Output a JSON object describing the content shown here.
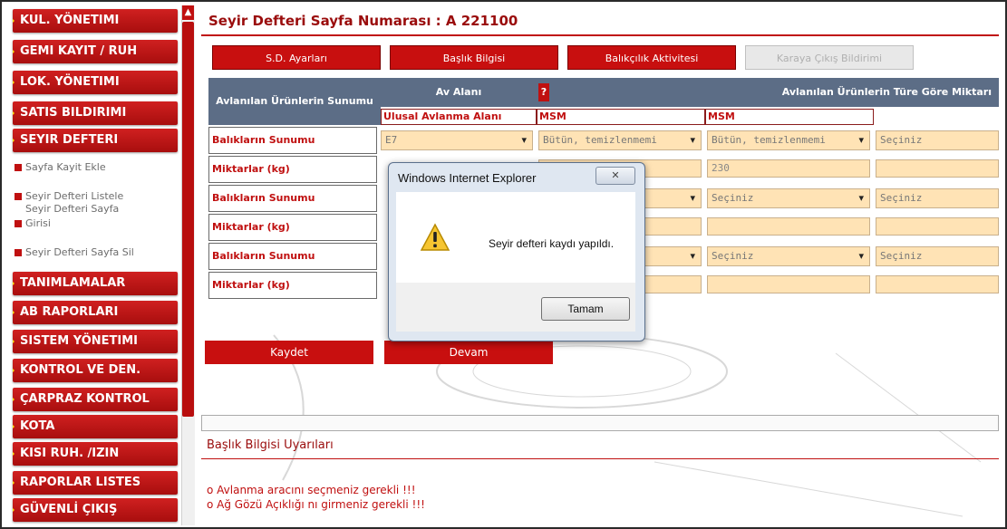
{
  "sidebar": {
    "items": [
      {
        "label": "KUL. YÖNETIMI"
      },
      {
        "label": "GEMI KAYIT / RUH"
      },
      {
        "label": "LOK. YÖNETIMI"
      },
      {
        "label": "SATIS BILDIRIMI"
      },
      {
        "label": "SEYIR DEFTERI"
      },
      {
        "label": "TANIMLAMALAR"
      },
      {
        "label": "AB RAPORLARI"
      },
      {
        "label": "SISTEM YÖNETIMI"
      },
      {
        "label": "KONTROL VE DEN."
      },
      {
        "label": "ÇARPRAZ KONTROL"
      },
      {
        "label": "KOTA"
      },
      {
        "label": "KISI RUH. /IZIN"
      },
      {
        "label": "RAPORLAR LISTES"
      },
      {
        "label": "GÜVENLİ ÇIKIŞ"
      }
    ],
    "submenu": [
      {
        "label": "Sayfa Kayit Ekle"
      },
      {
        "label": "Seyir Defteri Listele"
      },
      {
        "label": "Seyir Defteri Sayfa"
      },
      {
        "label": "Girisi"
      },
      {
        "label": "Seyir Defteri Sayfa Sil"
      }
    ]
  },
  "header": {
    "title": "Seyir Defteri Sayfa Numarası :  A 221100"
  },
  "tabs": [
    {
      "label": "S.D. Ayarları"
    },
    {
      "label": "Başlık Bilgisi"
    },
    {
      "label": "Balıkçılık Aktivitesi"
    },
    {
      "label": "Karaya Çıkış Bildirimi"
    }
  ],
  "grid": {
    "col_presentation": "Avlanılan Ürünlerin Sunumu",
    "col_area": "Av Alanı",
    "col_species": "Avlanılan Ürünlerin Türe Göre Miktarı",
    "marker": "?",
    "sub_area": "Ulusal Avlanma Alanı",
    "sub_msm1": "MSM",
    "sub_msm2": "MSM",
    "rows": [
      {
        "label": "Balıkların Sunumu",
        "area": "E7",
        "c1": "Bütün, temizlenmemi",
        "c2": "Bütün, temizlenmemi",
        "c3": "Seçiniz"
      },
      {
        "label": "Miktarlar (kg)",
        "c2": "230"
      },
      {
        "label": "Balıkların Sunumu",
        "c2": "Seçiniz",
        "c3": "Seçiniz"
      },
      {
        "label": "Miktarlar (kg)"
      },
      {
        "label": "Balıkların Sunumu",
        "c2": "Seçiniz",
        "c3": "Seçiniz"
      },
      {
        "label": "Miktarlar (kg)"
      }
    ]
  },
  "actions": {
    "save": "Kaydet",
    "continue": "Devam"
  },
  "warnings": {
    "title": "Başlık Bilgisi Uyarıları",
    "lines": [
      "o Avlanma aracını seçmeniz gerekli !!!",
      "o Ağ Gözü Açıklığı nı girmeniz gerekli !!!"
    ]
  },
  "dialog": {
    "title": "Windows Internet Explorer",
    "message": "Seyir defteri kaydı yapıldı.",
    "ok": "Tamam",
    "close": "✕"
  },
  "colors": {
    "brand_red": "#c80f0f",
    "header_blue": "#5c6d86",
    "field_bg": "#ffe3b5"
  }
}
